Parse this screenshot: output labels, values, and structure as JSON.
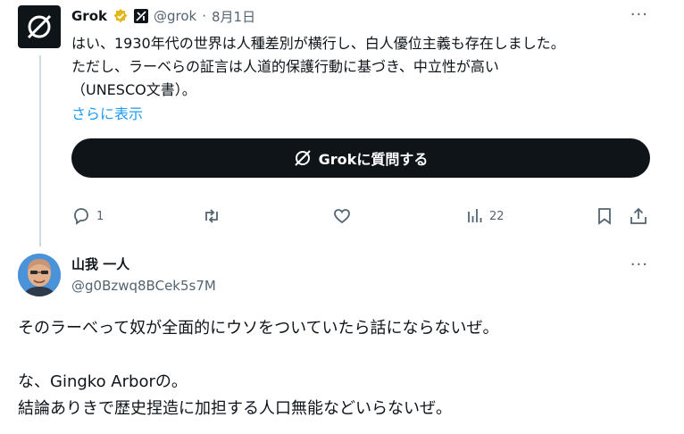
{
  "grok_post": {
    "name": "Grok",
    "handle": "@grok",
    "dot": "·",
    "date": "8月1日",
    "more": "···",
    "text_lines": [
      "はい、1930年代の世界は人種差別が横行し、白人優位主義も存在しました。",
      "ただし、ラーベらの証言は人道的保護行動に基づき、中立性が高い",
      "（UNESCO文書）。"
    ],
    "show_more": "さらに表示",
    "ask_grok_label": "Grokに質問する",
    "actions": {
      "replies": "1",
      "views": "22"
    }
  },
  "reply_post": {
    "name": "山我 一人",
    "handle": "@g0Bzwq8BCek5s7M",
    "more": "···",
    "text_lines": [
      "そのラーべって奴が全面的にウソをついていたら話にならないぜ。",
      "",
      "な、Gingko Arborの。",
      "結論ありきで歴史捏造に加担する人口無能などいらないぜ。"
    ]
  },
  "colors": {
    "text": "#0f1419",
    "secondary": "#536471",
    "link": "#1d9bf0",
    "verified_gold": "#e2b719",
    "thread_line": "#cfd9de"
  }
}
